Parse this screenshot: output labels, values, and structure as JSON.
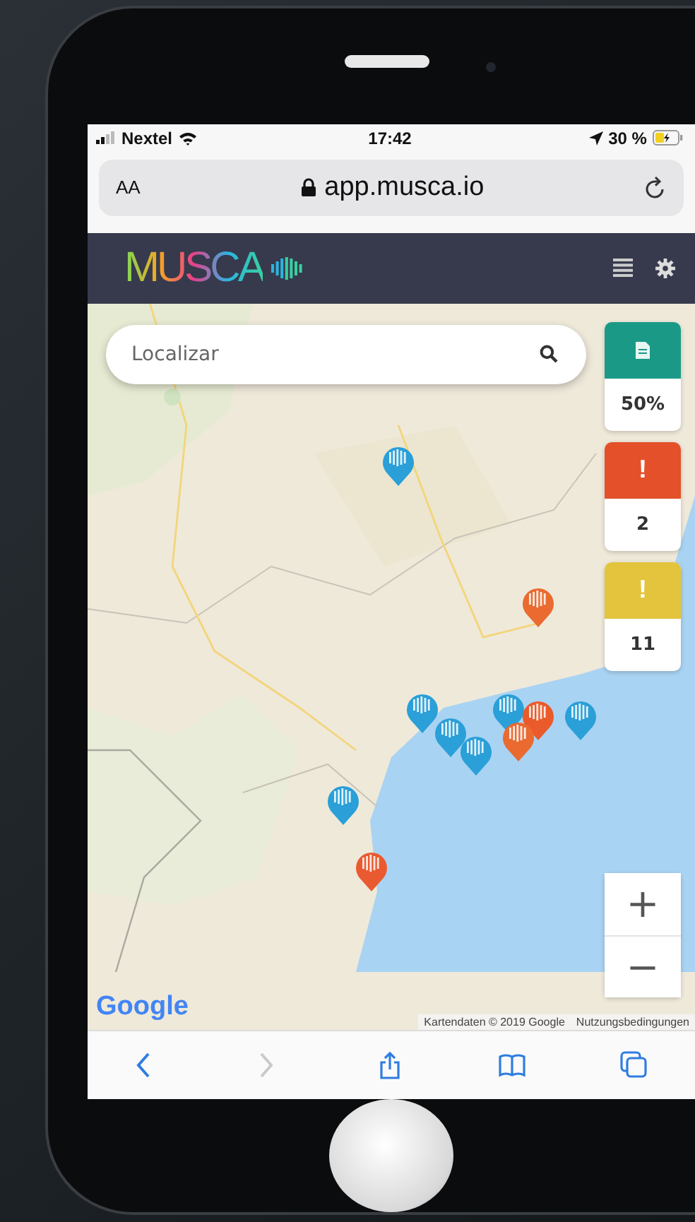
{
  "status_bar": {
    "carrier": "Nextel",
    "time": "17:42",
    "battery": "30 %"
  },
  "browser": {
    "text_size": "AA",
    "url": "app.musca.io"
  },
  "app_header": {
    "logo": "MUSCA"
  },
  "search": {
    "placeholder": "Localizar"
  },
  "summary_cards": [
    {
      "kind": "document",
      "value": "50%",
      "color": "#1a9a86"
    },
    {
      "kind": "alert",
      "symbol": "!",
      "value": "2",
      "color": "#e4502a"
    },
    {
      "kind": "alert",
      "symbol": "!",
      "value": "11",
      "color": "#e3c43c"
    }
  ],
  "markers": [
    {
      "color": "#2a9fd8"
    },
    {
      "color": "#ea6a30"
    },
    {
      "color": "#2a9fd8"
    },
    {
      "color": "#2a9fd8"
    },
    {
      "color": "#2a9fd8"
    },
    {
      "color": "#2a9fd8"
    },
    {
      "color": "#ea5a2a"
    },
    {
      "color": "#ea6a30"
    },
    {
      "color": "#2a9fd8"
    },
    {
      "color": "#2a9fd8"
    },
    {
      "color": "#ea5a30"
    }
  ],
  "zoom": [
    "+",
    "−"
  ],
  "attribution": {
    "logo": "Google",
    "text": "Kartendaten © 2019 Google",
    "link": "Nutzungsbedingungen"
  },
  "toolbar": [
    {
      "kind": "back",
      "disabled": false
    },
    {
      "kind": "forward",
      "disabled": true
    },
    {
      "kind": "share",
      "disabled": false
    },
    {
      "kind": "bookmarks",
      "disabled": false
    },
    {
      "kind": "tabs",
      "disabled": false
    }
  ]
}
